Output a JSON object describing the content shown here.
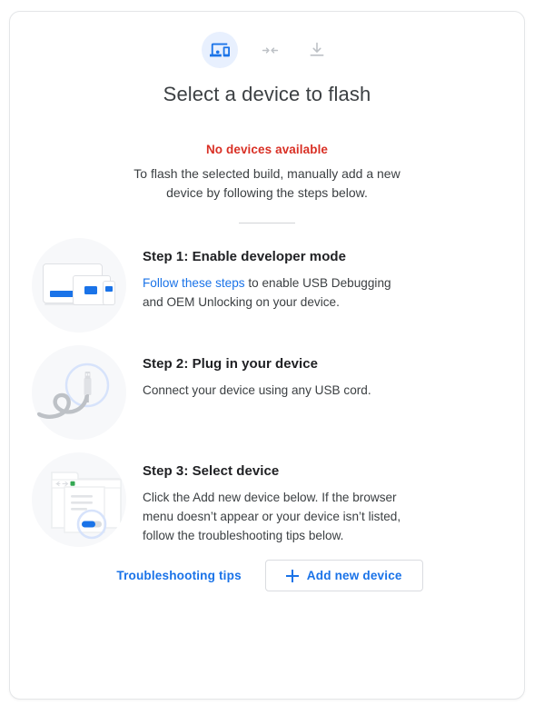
{
  "card": {
    "header_icons": [
      {
        "name": "devices-icon",
        "state": "active",
        "color": "#1a73e8",
        "bg": "#e8f0fe"
      },
      {
        "name": "connect-arrows-icon",
        "state": "inactive",
        "color": "#bdc1c6"
      },
      {
        "name": "download-icon",
        "state": "inactive",
        "color": "#bdc1c6"
      }
    ],
    "title": "Select a device to flash",
    "status": {
      "error": "No devices available",
      "description": "To flash the selected build, manually add a new device by following the steps below."
    },
    "steps": [
      {
        "art": "devices-illustration",
        "title": "Step 1: Enable developer mode",
        "link_text": "Follow these steps",
        "text": " to enable USB Debugging and OEM Unlocking on your device."
      },
      {
        "art": "usb-cable-illustration",
        "title": "Step 2: Plug in your device",
        "link_text": "",
        "text": "Connect your device using any USB cord."
      },
      {
        "art": "browser-dialog-illustration",
        "title": "Step 3: Select device",
        "link_text": "",
        "text": "Click the Add new device below. If the browser menu doesn’t appear or your device isn’t listed, follow the troubleshooting tips below."
      }
    ],
    "footer": {
      "troubleshooting_label": "Troubleshooting tips",
      "add_device_label": "Add new device",
      "add_device_icon": "plus-icon"
    },
    "colors": {
      "accent": "#1a73e8",
      "error": "#d93025",
      "text": "#3c4043",
      "heading": "#202124",
      "art_bg": "#f7f8fa",
      "icon_bg": "#e8f0fe"
    }
  }
}
